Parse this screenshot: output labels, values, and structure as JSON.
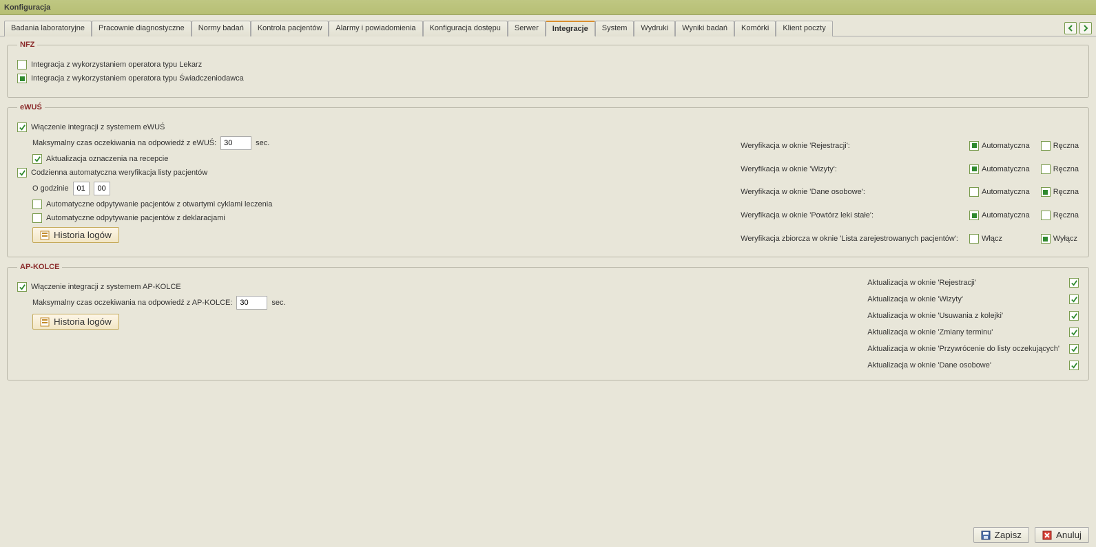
{
  "title": "Konfiguracja",
  "tabs": [
    "Badania laboratoryjne",
    "Pracownie diagnostyczne",
    "Normy badań",
    "Kontrola pacjentów",
    "Alarmy i powiadomienia",
    "Konfiguracja dostępu",
    "Serwer",
    "Integracje",
    "System",
    "Wydruki",
    "Wyniki badań",
    "Komórki",
    "Klient poczty"
  ],
  "activeTab": "Integracje",
  "nfz": {
    "legend": "NFZ",
    "opt_lekarz": "Integracja z wykorzystaniem operatora typu Lekarz",
    "opt_swiad": "Integracja z wykorzystaniem operatora typu Świadczeniodawca"
  },
  "ewus": {
    "legend": "eWUŚ",
    "enable": "Włączenie integracji z systemem eWUŚ",
    "maxwait_label": "Maksymalny czas oczekiwania na odpowiedź z eWUŚ:",
    "maxwait_value": "30",
    "sec": "sec.",
    "upd_recept": "Aktualizacja oznaczenia na recepcie",
    "daily_verify": "Codzienna automatyczna weryfikacja listy pacjentów",
    "at_hour_label": "O godzinie",
    "hour_h": "01",
    "hour_m": "00",
    "auto_cycles": "Automatyczne odpytywanie pacjentów z otwartymi cyklami leczenia",
    "auto_decl": "Automatyczne odpytywanie pacjentów z deklaracjami",
    "history_btn": "Historia logów",
    "ver_labels": [
      "Weryfikacja w oknie 'Rejestracji':",
      "Weryfikacja w oknie 'Wizyty':",
      "Weryfikacja w oknie 'Dane osobowe':",
      "Weryfikacja w oknie 'Powtórz leki stałe':",
      "Weryfikacja zbiorcza w oknie 'Lista zarejestrowanych pacjentów':"
    ],
    "col_auto": "Automatyczna",
    "col_manual": "Ręczna",
    "col_on": "Włącz",
    "col_off": "Wyłącz"
  },
  "apkolce": {
    "legend": "AP-KOLCE",
    "enable": "Włączenie integracji z systemem AP-KOLCE",
    "maxwait_label": "Maksymalny czas oczekiwania na odpowiedź z AP-KOLCE:",
    "maxwait_value": "30",
    "sec": "sec.",
    "history_btn": "Historia logów",
    "updates": [
      "Aktualizacja w oknie 'Rejestracji'",
      "Aktualizacja w oknie 'Wizyty'",
      "Aktualizacja w oknie 'Usuwania z kolejki'",
      "Aktualizacja w oknie 'Zmiany terminu'",
      "Aktualizacja w oknie 'Przywrócenie do listy oczekujących'",
      "Aktualizacja w oknie 'Dane osobowe'"
    ]
  },
  "footer": {
    "save": "Zapisz",
    "cancel": "Anuluj"
  }
}
